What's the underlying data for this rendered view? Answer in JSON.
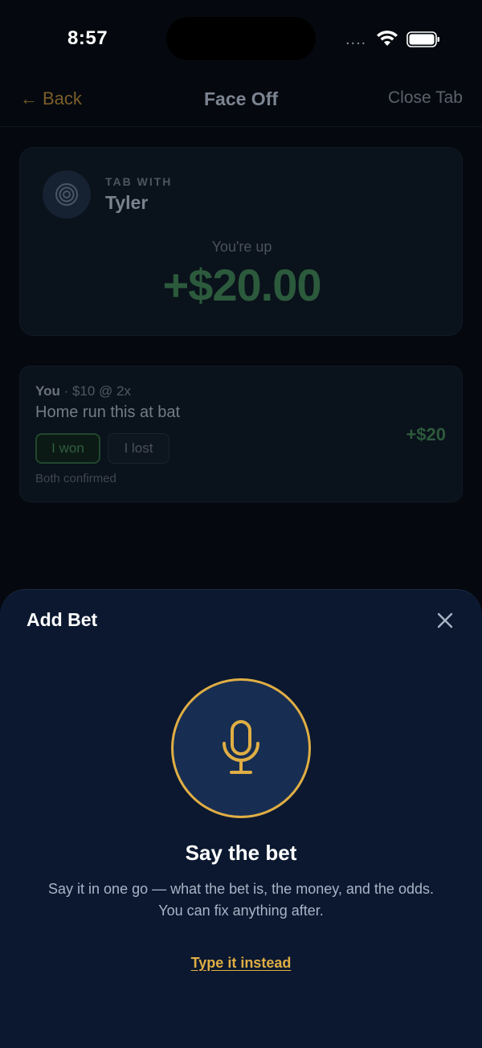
{
  "status_bar": {
    "time": "8:57",
    "dots": "...."
  },
  "nav": {
    "back_label": "Back",
    "back_arrow": "←",
    "title": "Face Off",
    "close_label": "Close Tab"
  },
  "tab_card": {
    "tab_with_label": "TAB WITH",
    "name": "Tyler",
    "standing_label": "You're up",
    "standing_amount": "+$20.00",
    "icon": "target-icon"
  },
  "bet": {
    "who": "You",
    "separator": " · ",
    "terms": "$10 @ 2x",
    "title": "Home run this at bat",
    "won_label": "I won",
    "lost_label": "I lost",
    "status": "Both confirmed",
    "amount": "+$20"
  },
  "sheet": {
    "title": "Add Bet",
    "close_icon": "close-icon",
    "mic_icon": "microphone-icon",
    "prompt_title": "Say the bet",
    "prompt_text": "Say it in one go — what the bet is, the money, and the odds. You can fix anything after.",
    "type_instead": "Type it instead"
  },
  "colors": {
    "accent": "#e0ae44",
    "sheet_bg": "#0b1830",
    "mic_bg": "#172e52",
    "positive_dim": "#2c5a3c"
  }
}
